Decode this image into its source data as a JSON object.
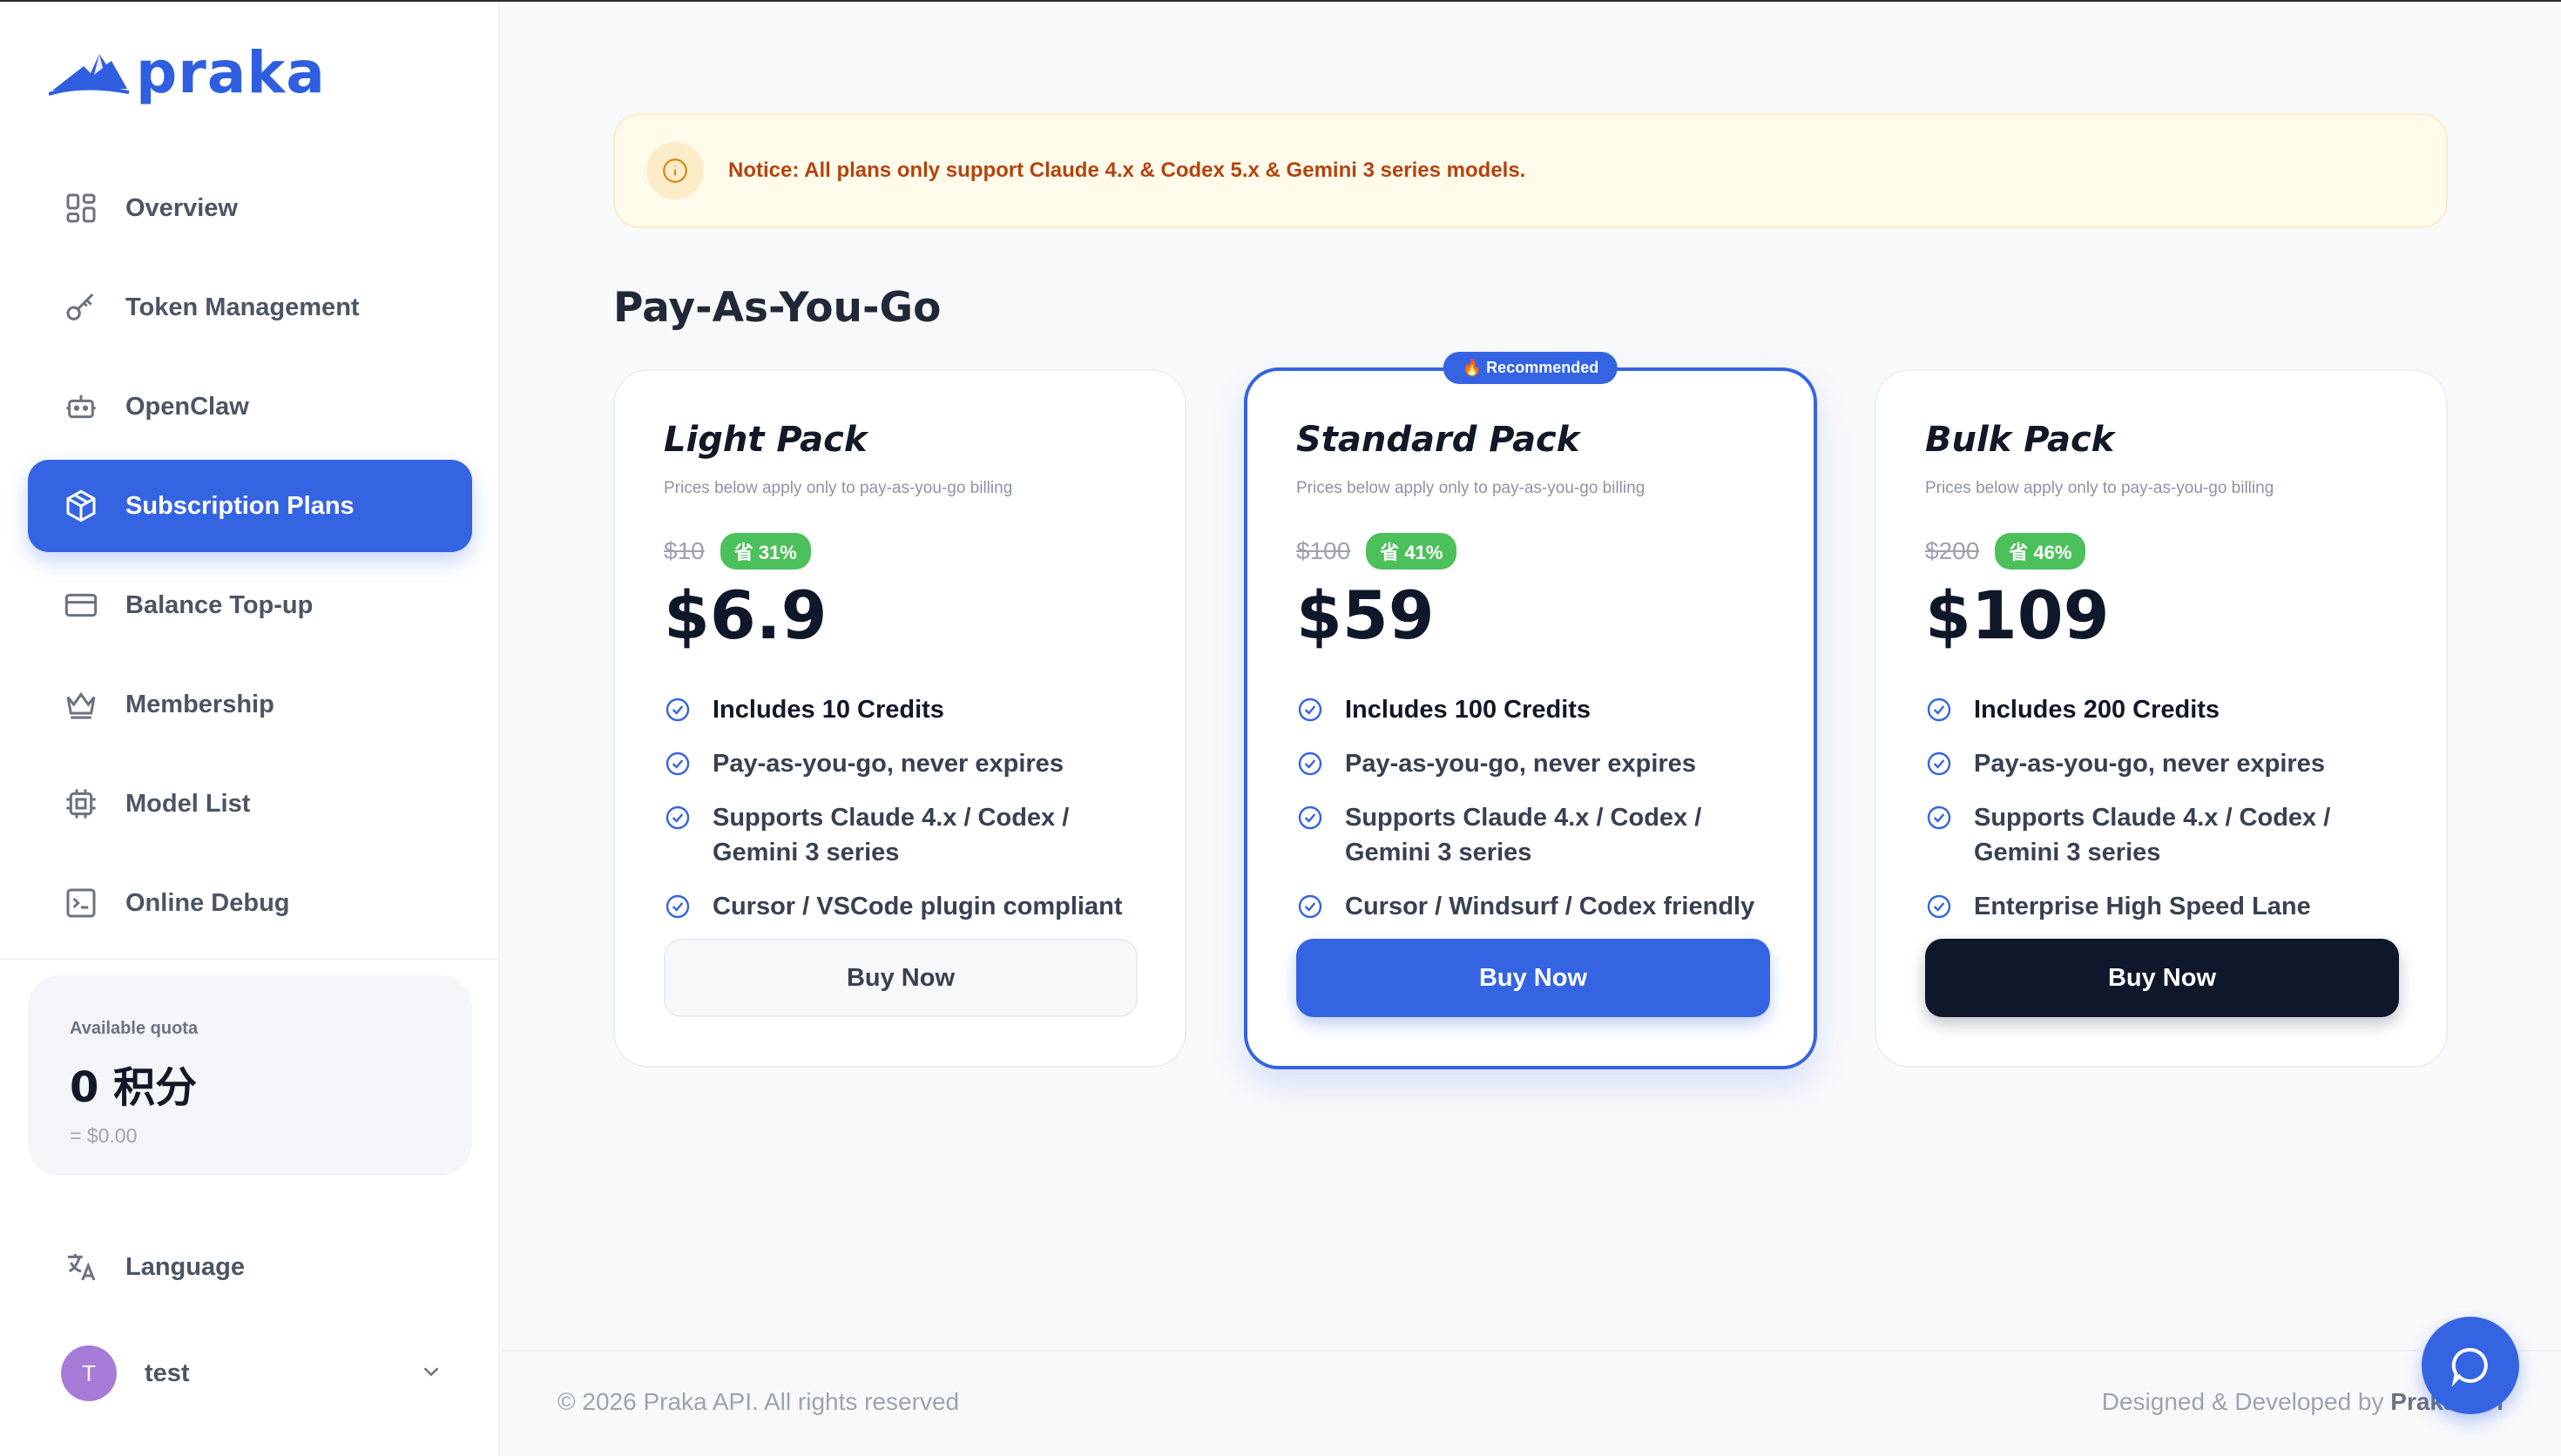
{
  "brand": {
    "name": "praka",
    "color": "#2f5fe0"
  },
  "sidebar": {
    "items": [
      {
        "label": "Overview",
        "icon": "grid-icon"
      },
      {
        "label": "Token Management",
        "icon": "key-icon"
      },
      {
        "label": "OpenClaw",
        "icon": "robot-icon"
      },
      {
        "label": "Subscription Plans",
        "icon": "box-icon",
        "active": true
      },
      {
        "label": "Balance Top-up",
        "icon": "credit-card-icon"
      },
      {
        "label": "Membership",
        "icon": "crown-icon"
      },
      {
        "label": "Model List",
        "icon": "chip-icon"
      },
      {
        "label": "Online Debug",
        "icon": "terminal-icon"
      }
    ],
    "quota": {
      "label": "Available quota",
      "value": "0 积分",
      "sub": "= $0.00"
    },
    "language": "Language",
    "user": {
      "initial": "T",
      "name": "test"
    }
  },
  "notice": {
    "text": "Notice: All plans only support Claude 4.x & Codex 5.x & Gemini 3 series models."
  },
  "section_title": "Pay-As-You-Go",
  "plans": [
    {
      "name": "Light Pack",
      "desc": "Prices below apply only to pay-as-you-go billing",
      "old_price": "$10",
      "discount": "省 31%",
      "price": "$6.9",
      "features": [
        "Includes 10 Credits",
        "Pay-as-you-go, never expires",
        "Supports Claude 4.x / Codex / Gemini 3 series",
        "Cursor / VSCode plugin compliant"
      ],
      "button": "Buy Now"
    },
    {
      "name": "Standard Pack",
      "badge": "🔥 Recommended",
      "desc": "Prices below apply only to pay-as-you-go billing",
      "old_price": "$100",
      "discount": "省 41%",
      "price": "$59",
      "features": [
        "Includes 100 Credits",
        "Pay-as-you-go, never expires",
        "Supports Claude 4.x / Codex / Gemini 3 series",
        "Cursor / Windsurf / Codex friendly"
      ],
      "button": "Buy Now"
    },
    {
      "name": "Bulk Pack",
      "desc": "Prices below apply only to pay-as-you-go billing",
      "old_price": "$200",
      "discount": "省 46%",
      "price": "$109",
      "features": [
        "Includes 200 Credits",
        "Pay-as-you-go, never expires",
        "Supports Claude 4.x / Codex / Gemini 3 series",
        "Enterprise High Speed Lane"
      ],
      "button": "Buy Now"
    }
  ],
  "footer": {
    "left": "© 2026 Praka API. All rights reserved",
    "right_prefix": "Designed & Developed by",
    "right_name": "Praka API"
  }
}
